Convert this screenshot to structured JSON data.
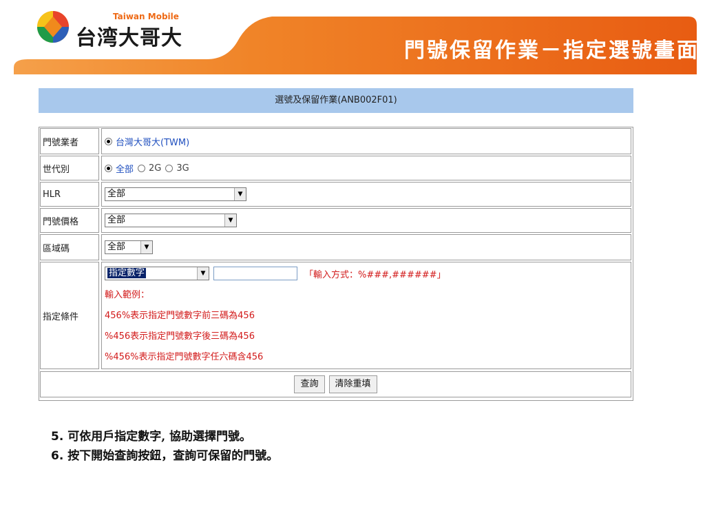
{
  "header": {
    "logo_en": "Taiwan Mobile",
    "logo_zh": "台湾大哥大",
    "page_heading": "門號保留作業－指定選號畫面",
    "colors": {
      "accent": "#f07a20",
      "accent_dark": "#e25a10"
    }
  },
  "form": {
    "title": "選號及保留作業(ANB002F01)",
    "rows": {
      "carrier": {
        "label": "門號業者",
        "option": "台灣大哥大(TWM)"
      },
      "generation": {
        "label": "世代別",
        "options": [
          "全部",
          "2G",
          "3G"
        ],
        "selected": "全部"
      },
      "hlr": {
        "label": "HLR",
        "value": "全部"
      },
      "price": {
        "label": "門號價格",
        "value": "全部"
      },
      "area": {
        "label": "區域碼",
        "value": "全部"
      },
      "condition": {
        "label": "指定條件",
        "select_value": "指定數字",
        "input_value": "",
        "format_hint": "「輸入方式：%###,######」",
        "example_title": "輸入範例：",
        "examples": [
          "456%表示指定門號數字前三碼為456",
          "%456表示指定門號數字後三碼為456",
          "%456%表示指定門號數字任六碼含456"
        ]
      }
    },
    "buttons": {
      "query": "查詢",
      "reset": "清除重填"
    }
  },
  "notes": [
    {
      "num": "5.",
      "text": "可依用戶指定數字, 協助選擇門號。"
    },
    {
      "num": "6.",
      "text": "按下開始查詢按鈕，查詢可保留的門號。"
    }
  ]
}
